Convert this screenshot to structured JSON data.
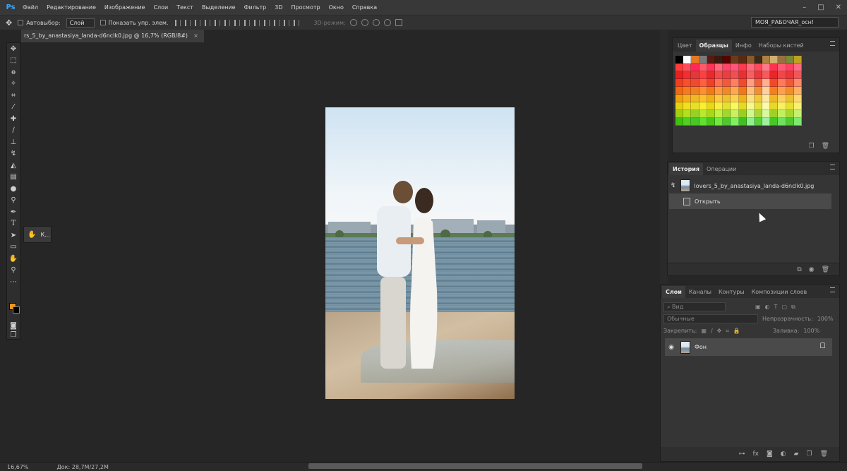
{
  "app": {
    "logo": "Ps"
  },
  "menu": [
    "Файл",
    "Редактирование",
    "Изображение",
    "Слои",
    "Текст",
    "Выделение",
    "Фильтр",
    "3D",
    "Просмотр",
    "Окно",
    "Справка"
  ],
  "window_controls": [
    "–",
    "□",
    "✕"
  ],
  "options": {
    "auto_select_label": "Автовыбор:",
    "auto_select_value": "Слой",
    "show_transform_label": "Показать упр. элем.",
    "mode_3d_label": "3D-режим:",
    "workspace": "МОЯ_РАБОЧАЯ_осн!"
  },
  "document": {
    "tab_title": "rs_5_by_anastasiya_landa-d6nclk0.jpg @ 16,7% (RGB/8#)",
    "close_glyph": "×"
  },
  "toolbar": {
    "tools": [
      "move-icon",
      "marquee-icon",
      "lasso-icon",
      "magic-wand-icon",
      "crop-icon",
      "eyedropper-icon",
      "healing-brush-icon",
      "brush-icon",
      "clone-stamp-icon",
      "history-brush-icon",
      "eraser-icon",
      "gradient-icon",
      "blur-icon",
      "dodge-icon",
      "pen-icon",
      "type-icon",
      "path-selection-icon",
      "shape-icon",
      "hand-icon",
      "zoom-icon",
      "more-tools-icon"
    ],
    "foreground_color": "#f7941d",
    "background_color": "#000000"
  },
  "mini_panel": {
    "label": "К..."
  },
  "swatches_panel": {
    "tabs": [
      "Цвет",
      "Образцы",
      "Инфо",
      "Наборы кистей"
    ],
    "active_tab": "Образцы"
  },
  "history_panel": {
    "tabs": [
      "История",
      "Операции"
    ],
    "active_tab": "История",
    "snapshot": "lovers_5_by_anastasiya_landa-d6nclk0.jpg",
    "steps": [
      "Открыть"
    ]
  },
  "layers_panel": {
    "tabs": [
      "Слои",
      "Каналы",
      "Контуры",
      "Композиции слоев"
    ],
    "active_tab": "Слои",
    "filter_placeholder": "Вид",
    "blend_mode": "Обычные",
    "opacity_label": "Непрозрачность:",
    "opacity_value": "100%",
    "lock_label": "Закрепить:",
    "fill_label": "Заливка:",
    "fill_value": "100%",
    "layers": [
      {
        "name": "Фон"
      }
    ]
  },
  "status": {
    "zoom": "16,67%",
    "doc_size": "Док: 28,7M/27,2M"
  }
}
